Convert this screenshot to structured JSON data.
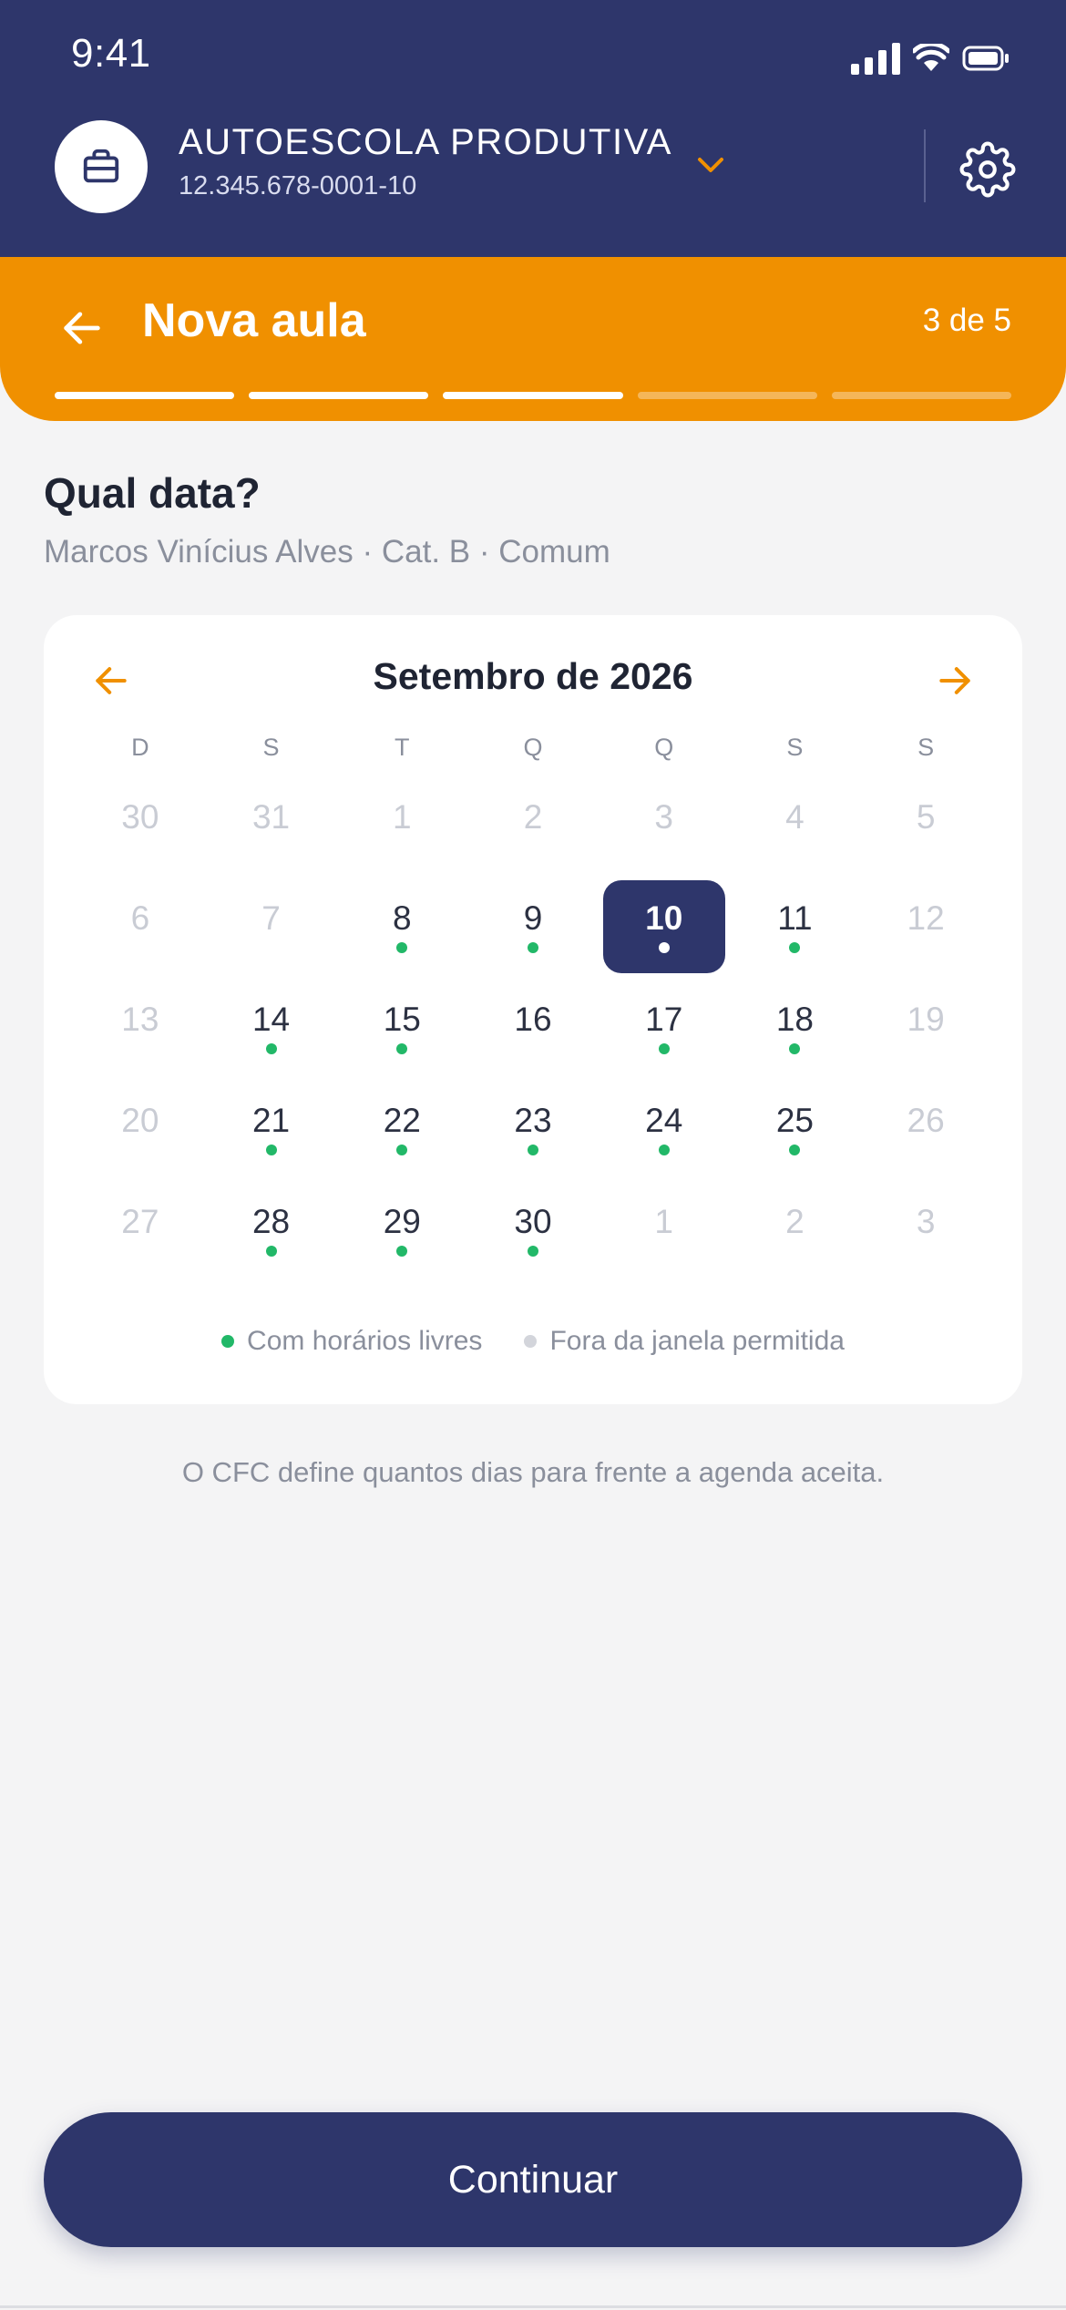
{
  "status_bar": {
    "time": "9:41"
  },
  "header": {
    "company_name": "AUTOESCOLA PRODUTIVA",
    "company_id": "12.345.678-0001-10"
  },
  "wizard": {
    "title": "Nova aula",
    "step_label": "3 de 5",
    "total_steps": 5,
    "completed_steps": 3
  },
  "question": {
    "title": "Qual data?",
    "subtitle": "Marcos Vinícius Alves · Cat. B · Comum"
  },
  "calendar": {
    "month_label": "Setembro de 2026",
    "weekdays": [
      "D",
      "S",
      "T",
      "Q",
      "Q",
      "S",
      "S"
    ],
    "days": [
      {
        "label": "30",
        "state": "muted"
      },
      {
        "label": "31",
        "state": "muted"
      },
      {
        "label": "1",
        "state": "muted"
      },
      {
        "label": "2",
        "state": "muted"
      },
      {
        "label": "3",
        "state": "muted"
      },
      {
        "label": "4",
        "state": "muted"
      },
      {
        "label": "5",
        "state": "muted"
      },
      {
        "label": "6",
        "state": "muted"
      },
      {
        "label": "7",
        "state": "muted"
      },
      {
        "label": "8",
        "state": "available"
      },
      {
        "label": "9",
        "state": "available"
      },
      {
        "label": "10",
        "state": "selected"
      },
      {
        "label": "11",
        "state": "available"
      },
      {
        "label": "12",
        "state": "muted"
      },
      {
        "label": "13",
        "state": "muted"
      },
      {
        "label": "14",
        "state": "available"
      },
      {
        "label": "15",
        "state": "available"
      },
      {
        "label": "16",
        "state": "normal"
      },
      {
        "label": "17",
        "state": "available"
      },
      {
        "label": "18",
        "state": "available"
      },
      {
        "label": "19",
        "state": "muted"
      },
      {
        "label": "20",
        "state": "muted"
      },
      {
        "label": "21",
        "state": "available"
      },
      {
        "label": "22",
        "state": "available"
      },
      {
        "label": "23",
        "state": "available"
      },
      {
        "label": "24",
        "state": "available"
      },
      {
        "label": "25",
        "state": "available"
      },
      {
        "label": "26",
        "state": "muted"
      },
      {
        "label": "27",
        "state": "muted"
      },
      {
        "label": "28",
        "state": "available"
      },
      {
        "label": "29",
        "state": "available"
      },
      {
        "label": "30",
        "state": "available"
      },
      {
        "label": "1",
        "state": "muted"
      },
      {
        "label": "2",
        "state": "muted"
      },
      {
        "label": "3",
        "state": "muted"
      }
    ],
    "legend": {
      "available": "Com horários livres",
      "outside": "Fora da janela permitida"
    }
  },
  "note": "O CFC define quantos dias para frente a agenda aceita.",
  "continue_label": "Continuar",
  "colors": {
    "primary": "#2e366b",
    "accent": "#f09000",
    "available_dot": "#22b868",
    "outside_dot": "#d3d5db",
    "muted_text": "#c9ccd4"
  },
  "icons": {
    "company": "briefcase-icon",
    "dropdown": "chevron-down-icon",
    "settings": "gear-icon",
    "back": "arrow-left-icon",
    "prev_month": "arrow-left-icon",
    "next_month": "arrow-right-icon"
  }
}
